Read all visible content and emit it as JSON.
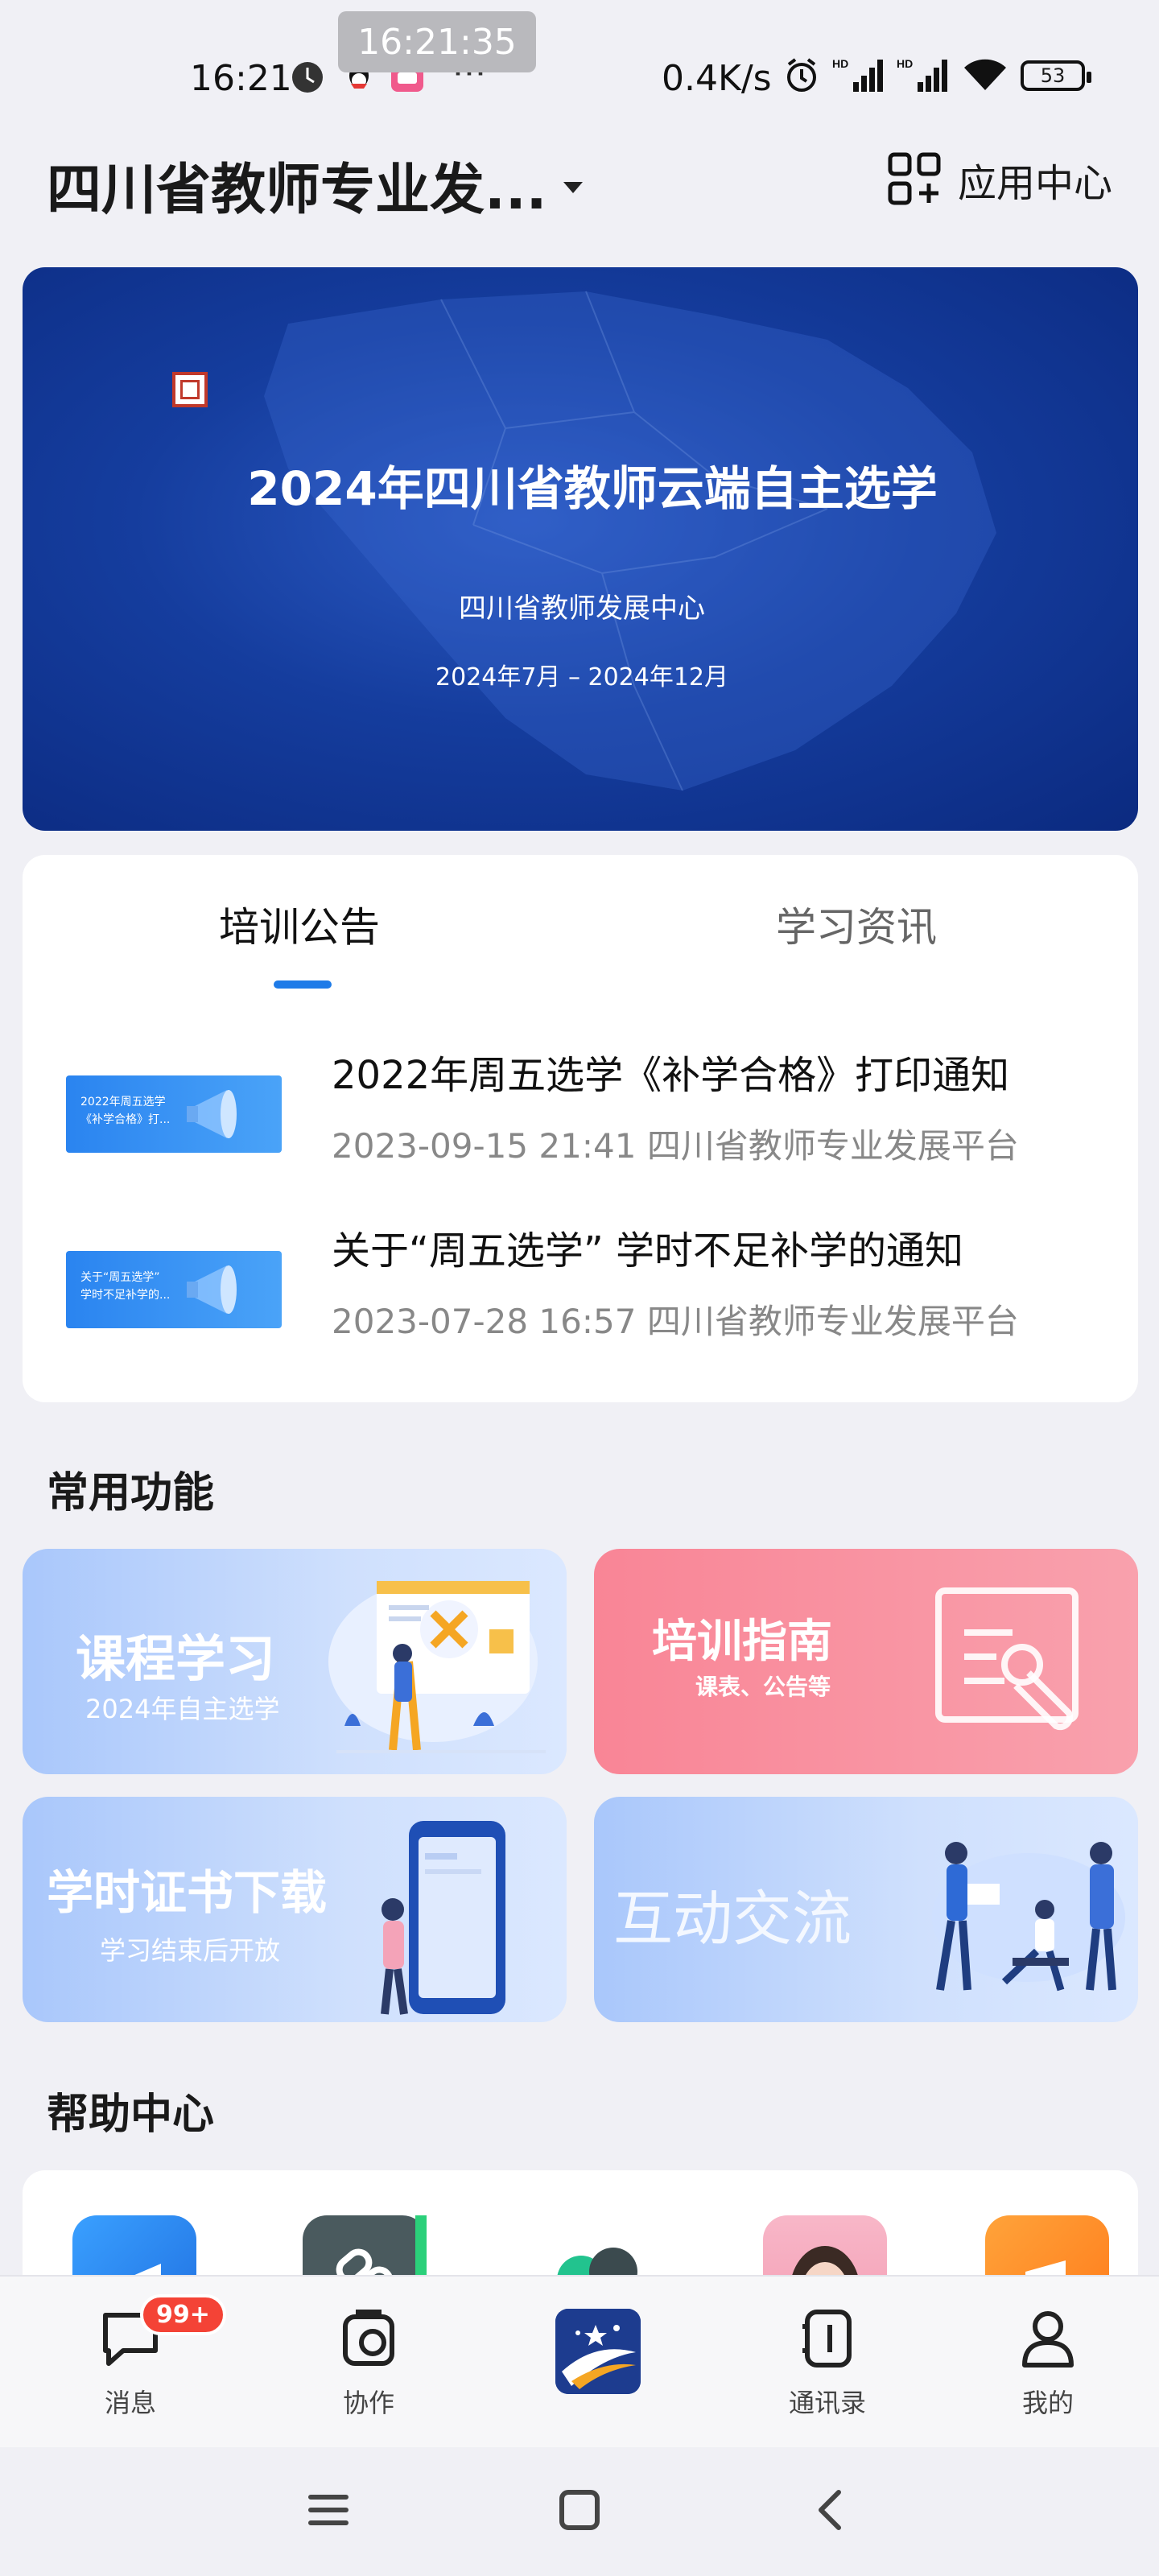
{
  "status_bar": {
    "time": "16:21",
    "clock_overlay": "16:21:35",
    "net_speed": "0.4K/s",
    "battery": "53"
  },
  "header": {
    "org_title": "四川省教师专业发...",
    "app_center_label": "应用中心"
  },
  "banner": {
    "title": "2024年四川省教师云端自主选学",
    "subtitle": "四川省教师发展中心",
    "date_range": "2024年7月  –  2024年12月"
  },
  "notice": {
    "tabs": [
      {
        "label": "培训公告",
        "active": true
      },
      {
        "label": "学习资讯",
        "active": false
      }
    ],
    "items": [
      {
        "thumb_text": [
          "2022年周五选学",
          "《补学合格》打..."
        ],
        "title": "2022年周五选学《补学合格》打印通知",
        "meta": "2023-09-15 21:41 四川省教师专业发展平台"
      },
      {
        "thumb_text": [
          "关于“周五选学”",
          "学时不足补学的..."
        ],
        "title": "关于“周五选学” 学时不足补学的通知",
        "meta": "2023-07-28 16:57 四川省教师专业发展平台"
      }
    ]
  },
  "functions": {
    "section_title": "常用功能",
    "tiles": [
      {
        "label": "课程学习",
        "sub": "2024年自主选学"
      },
      {
        "label": "培训指南",
        "sub": "课表、公告等"
      },
      {
        "label": "学时证书下载",
        "sub": "学习结束后开放"
      },
      {
        "label": "互动交流",
        "sub": ""
      }
    ]
  },
  "help": {
    "section_title": "帮助中心"
  },
  "bottom_nav": {
    "items": [
      {
        "label": "消息",
        "badge": "99+"
      },
      {
        "label": "协作"
      },
      {
        "label": ""
      },
      {
        "label": "通讯录"
      },
      {
        "label": "我的"
      }
    ]
  },
  "colors": {
    "accent": "#1e7be8",
    "banner_blue": "#153d9e",
    "badge_red": "#f44336"
  }
}
